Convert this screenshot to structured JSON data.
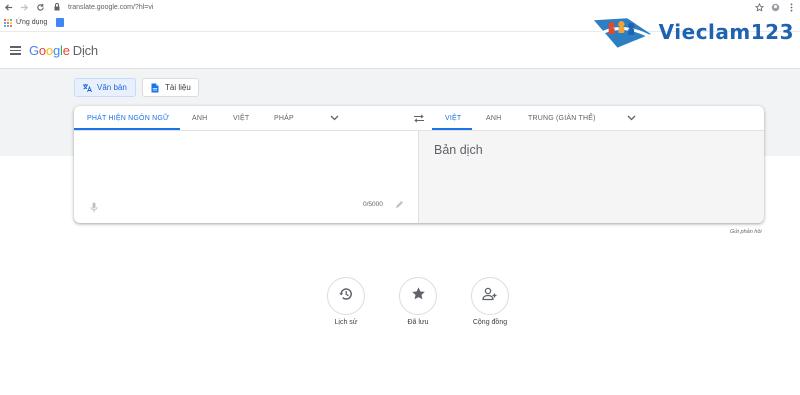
{
  "browser": {
    "url": "translate.google.com/?hl=vi",
    "bookmark_apps_label": "Ứng dụng"
  },
  "watermark": {
    "text": "Vieclam123"
  },
  "header": {
    "brand_letters": [
      "G",
      "o",
      "o",
      "g",
      "l",
      "e"
    ],
    "product": "Dịch"
  },
  "modes": [
    {
      "label": "Văn bản",
      "icon": "translate-icon",
      "active": true
    },
    {
      "label": "Tài liệu",
      "icon": "document-icon",
      "active": false
    }
  ],
  "source_languages": [
    "PHÁT HIỆN NGÔN NGỮ",
    "ANH",
    "VIỆT",
    "PHÁP"
  ],
  "target_languages": [
    "VIỆT",
    "ANH",
    "TRUNG (GIẢN THỂ)"
  ],
  "source": {
    "text": "",
    "char_count": "0/5000"
  },
  "target": {
    "placeholder": "Bản dịch"
  },
  "feedback_label": "Gửi phản hồi",
  "actions": [
    {
      "label": "Lịch sử",
      "icon": "history-icon"
    },
    {
      "label": "Đã lưu",
      "icon": "star-icon"
    },
    {
      "label": "Cộng đồng",
      "icon": "community-icon"
    }
  ],
  "colors": {
    "accent": "#1a73e8",
    "band": "#f1f3f4",
    "active_mode_bg": "#e8f0fe"
  }
}
